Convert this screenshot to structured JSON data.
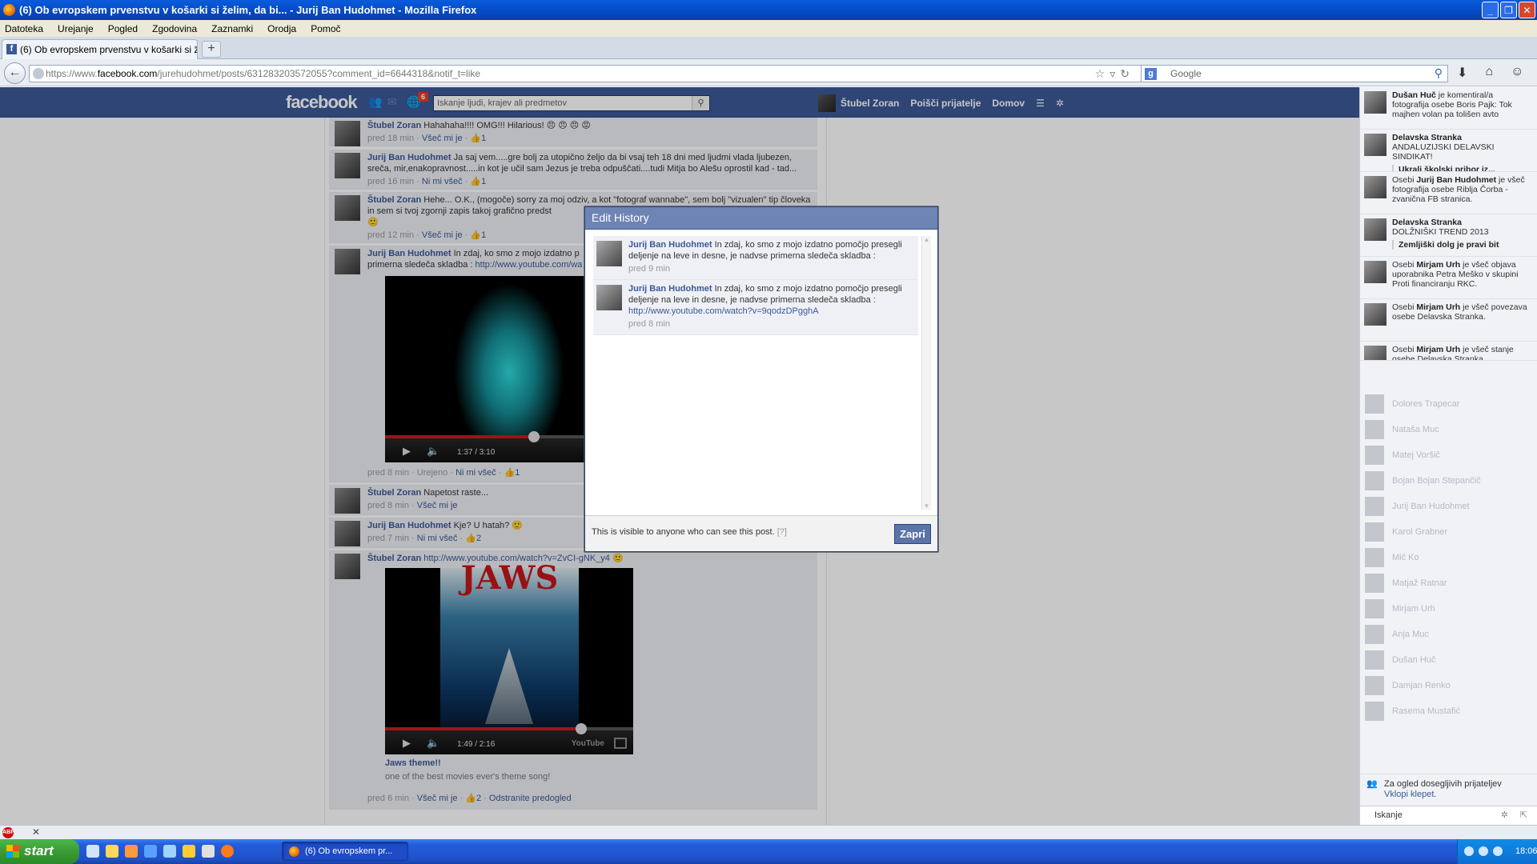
{
  "window": {
    "title": "(6) Ob evropskem prvenstvu v košarki si želim, da bi... - Jurij Ban Hudohmet - Mozilla Firefox"
  },
  "menu": [
    "Datoteka",
    "Urejanje",
    "Pogled",
    "Zgodovina",
    "Zaznamki",
    "Orodja",
    "Pomoč"
  ],
  "tab": {
    "label": "(6) Ob evropskem prvenstvu v košarki si želi..."
  },
  "url": {
    "prefix": "https://www.",
    "host": "facebook.com",
    "path": "/jurehudohmet/posts/631283203572055?comment_id=6644318&notif_t=like"
  },
  "browser_search": {
    "placeholder": "Google"
  },
  "fb": {
    "logo": "facebook",
    "badge": "6",
    "search_placeholder": "Iskanje ljudi, krajev ali predmetov",
    "nav_user": "Štubel Zoran",
    "nav_friends": "Poišči prijatelje",
    "nav_home": "Domov"
  },
  "comments": [
    {
      "name": "Štubel Zoran",
      "text": "Hahahaha!!!! OMG!!! Hilarious! 😠 😠 😠 😡",
      "time": "pred 18 min",
      "action": "Všeč mi je",
      "likes": "1"
    },
    {
      "name": "Jurij Ban Hudohmet",
      "text": "Ja saj vem.....gre bolj za utopično željo da bi vsaj teh 18 dni med ljudmi vlada ljubezen, sreča, mir,enakopravnost.....in kot je učil sam Jezus je treba odpuščati....tudi Mitja bo Alešu oprostil kad - tad...",
      "time": "pred 16 min",
      "action": "Ni mi všeč",
      "likes": "1"
    },
    {
      "name": "Štubel Zoran",
      "text": "Hehe... O.K., (mogoče) sorry za moj odziv, a kot \"fotograf wannabe\", sem bolj \"vizualen\" tip človeka in sem si tvoj zgornji zapis takoj grafično predst",
      "time": "pred 12 min",
      "action": "Všeč mi je",
      "likes": "1"
    },
    {
      "name": "Jurij Ban Hudohmet",
      "text": "In zdaj, ko smo z mojo izdatno p",
      "text2": "primerna sledeča skladba :",
      "link": "http://www.youtube.com/wa",
      "time": "pred 8 min",
      "edited": "Urejeno",
      "action": "Ni mi všeč",
      "likes": "1",
      "video": {
        "time": "1:37 / 3:10",
        "progress": 0.6
      }
    },
    {
      "name": "Štubel Zoran",
      "text": "Napetost raste...",
      "time": "pred 8 min",
      "action": "Všeč mi je"
    },
    {
      "name": "Jurij Ban Hudohmet",
      "text": "Kje? U hatah? 🙂",
      "time": "pred 7 min",
      "action": "Ni mi všeč",
      "likes": "2"
    },
    {
      "name": "Štubel Zoran",
      "link": "http://www.youtube.com/watch?v=ZvCI-gNK_y4",
      "time": "pred 6 min",
      "action": "Všeč mi je",
      "likes": "2",
      "remove": "Odstranite predogled",
      "video": {
        "title_art": "JAWS",
        "time": "1:49 / 2:16",
        "progress": 0.79,
        "caption": "Jaws theme!!",
        "desc": "one of the best movies ever's theme song!"
      }
    }
  ],
  "dialog": {
    "title": "Edit History",
    "items": [
      {
        "name": "Jurij Ban Hudohmet",
        "text": "In zdaj, ko smo z mojo izdatno pomočjo presegli deljenje na leve in desne, je nadvse primerna sledeča skladba :",
        "time": "pred 9 min"
      },
      {
        "name": "Jurij Ban Hudohmet",
        "text": "In zdaj, ko smo z mojo izdatno pomočjo presegli deljenje na leve in desne, je nadvse primerna sledeča skladba :",
        "link": "http://www.youtube.com/watch?v=9qodzDPgghA",
        "time": "pred 8 min"
      }
    ],
    "footer": "This is visible to anyone who can see this post.",
    "help": "[?]",
    "close": "Zapri"
  },
  "ticker": [
    {
      "bold": "Dušan Huč",
      "text": " je komentiral/a fotografija osebe Boris Pajk: Tok majhen volan pa tolišen avto"
    },
    {
      "bold": "Delavska Stranka",
      "text": "ANDALUZIJSKI DELAVSKI SINDIKAT!",
      "sub": "Ukrali školski pribor iz..."
    },
    {
      "pre": "Osebi ",
      "bold": "Jurij Ban Hudohmet",
      "text": " je všeč fotografija osebe Riblja Čorba - zvanična FB stranica."
    },
    {
      "bold": "Delavska Stranka",
      "text": "DOLŽNIŠKI TREND 2013",
      "sub": "Zemljiški dolg je pravi bit"
    },
    {
      "pre": "Osebi ",
      "bold": "Mirjam Urh",
      "text": " je všeč objava uporabnika Petra Meško v skupini Proti financiranju RKC."
    },
    {
      "pre": "Osebi ",
      "bold": "Mirjam Urh",
      "text": " je všeč povezava osebe Delavska Stranka."
    },
    {
      "pre": "Osebi ",
      "bold": "Mirjam Urh",
      "text": " je všeč stanje osebe Delavska Stranka."
    }
  ],
  "chat": [
    "Dolores Trapecar",
    "Nataša Muc",
    "Matej Voršič",
    "Bojan Bojan Stepančič",
    "Jurij Ban Hudohmet",
    "Karol Grabner",
    "Mič Ko",
    "Matjaž Ratnar",
    "Mirjam Urh",
    "Anja Muc",
    "Dušan Huč",
    "Damjan Renko",
    "Rasema Mustafić"
  ],
  "chat_footer": {
    "text": "Za ogled dosegljivih prijateljev",
    "link": "Vklopi klepet."
  },
  "chat_search": "Iskanje",
  "taskbar": {
    "start": "start",
    "item": "(6) Ob evropskem pr...",
    "clock": "18:06"
  }
}
